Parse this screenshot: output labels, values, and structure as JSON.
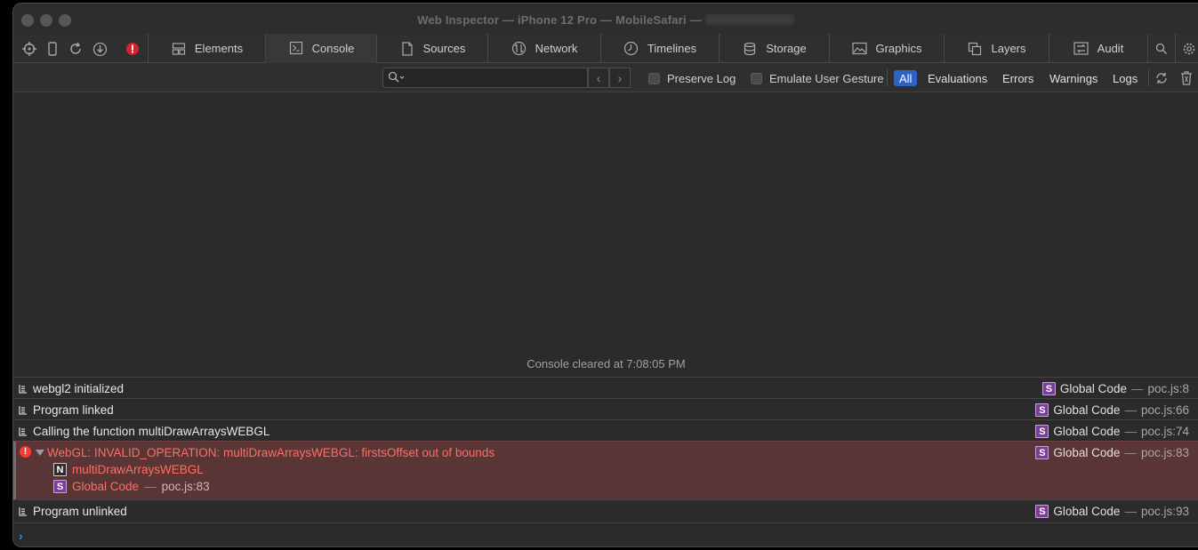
{
  "window": {
    "title": "Web Inspector — iPhone 12 Pro — MobileSafari —"
  },
  "toolbar_icons": [
    "crosshair-icon",
    "device-icon",
    "reload-icon",
    "download-icon",
    "error-badge-icon"
  ],
  "tabs": [
    {
      "label": "Elements",
      "icon": "elements-icon"
    },
    {
      "label": "Console",
      "icon": "console-icon",
      "active": true
    },
    {
      "label": "Sources",
      "icon": "document-icon"
    },
    {
      "label": "Network",
      "icon": "network-icon"
    },
    {
      "label": "Timelines",
      "icon": "clock-icon"
    },
    {
      "label": "Storage",
      "icon": "database-icon"
    },
    {
      "label": "Graphics",
      "icon": "image-icon"
    },
    {
      "label": "Layers",
      "icon": "layers-icon"
    },
    {
      "label": "Audit",
      "icon": "audit-icon"
    }
  ],
  "filter": {
    "search_placeholder": "",
    "preserve_log": "Preserve Log",
    "emulate_gesture": "Emulate User Gesture",
    "levels": [
      "All",
      "Evaluations",
      "Errors",
      "Warnings",
      "Logs"
    ],
    "active_level": "All"
  },
  "console": {
    "cleared": "Console cleared at 7:08:05 PM",
    "messages": [
      {
        "text": "webgl2 initialized",
        "badge": "S",
        "func": "Global Code",
        "file": "poc.js:8"
      },
      {
        "text": "Program linked",
        "badge": "S",
        "func": "Global Code",
        "file": "poc.js:66"
      },
      {
        "text": "Calling the function multiDrawArraysWEBGL",
        "badge": "S",
        "func": "Global Code",
        "file": "poc.js:74"
      },
      {
        "text": "WebGL: INVALID_OPERATION: multiDrawArraysWEBGL: firstsOffset out of bounds",
        "badge": "S",
        "func": "Global Code",
        "file": "poc.js:83",
        "level": "error",
        "stack": [
          {
            "badge": "N",
            "func": "multiDrawArraysWEBGL",
            "file": ""
          },
          {
            "badge": "S",
            "func": "Global Code",
            "file": "poc.js:83"
          }
        ]
      },
      {
        "text": "Program unlinked",
        "badge": "S",
        "func": "Global Code",
        "file": "poc.js:93"
      }
    ]
  },
  "colors": {
    "accent": "#2f62c5",
    "error_bg": "#5a3535",
    "error_text": "#ff6e64",
    "source_badge": "#7b3f98"
  }
}
